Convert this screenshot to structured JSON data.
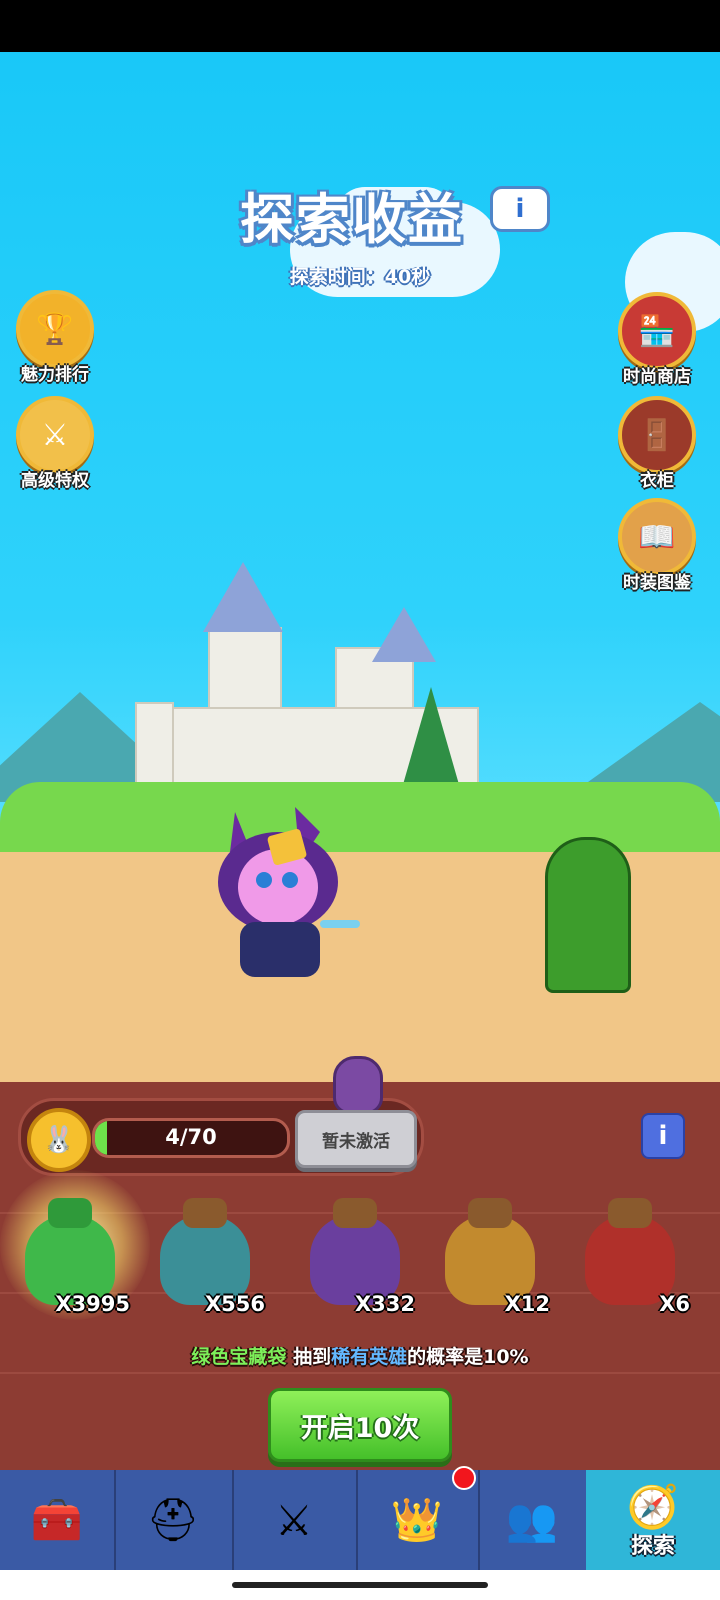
{
  "header": {
    "title": "探索收益",
    "info_icon": "info-icon",
    "subtitle": "探索时间：40秒"
  },
  "side_buttons": {
    "left": [
      {
        "label": "魅力排行",
        "icon": "podium-icon"
      },
      {
        "label": "高级特权",
        "icon": "sword-badge-icon"
      }
    ],
    "right": [
      {
        "label": "时尚商店",
        "icon": "shop-awning-icon"
      },
      {
        "label": "衣柜",
        "icon": "wardrobe-icon"
      },
      {
        "label": "时装图鉴",
        "icon": "book-icon"
      }
    ]
  },
  "progress": {
    "text": "4/70",
    "value": 4,
    "max": 70,
    "inactive_label": "暂未激活"
  },
  "bags": [
    {
      "count": "X3995",
      "color": "#3fb84a",
      "neck": "#2f9a3a"
    },
    {
      "count": "X556",
      "color": "#3b8f97",
      "neck": "#8a5a2d"
    },
    {
      "count": "X332",
      "color": "#6a3f9e",
      "neck": "#8a5a2d"
    },
    {
      "count": "X12",
      "color": "#c28a2e",
      "neck": "#8a5a2d"
    },
    {
      "count": "X6",
      "color": "#b0302a",
      "neck": "#8a5a2d"
    }
  ],
  "probability": {
    "bag_name": "绿色宝藏袋",
    "part1": "抽到",
    "rarity": "稀有英雄",
    "part2": "的概率是10%"
  },
  "open_button": "开启10次",
  "nav": {
    "items": [
      {
        "icon": "treasure-chest-icon"
      },
      {
        "icon": "knight-helmet-icon"
      },
      {
        "icon": "crossed-swords-icon"
      },
      {
        "icon": "crown-shield-icon"
      },
      {
        "icon": "team-banner-icon"
      },
      {
        "icon": "compass-icon",
        "label": "探索"
      }
    ]
  }
}
